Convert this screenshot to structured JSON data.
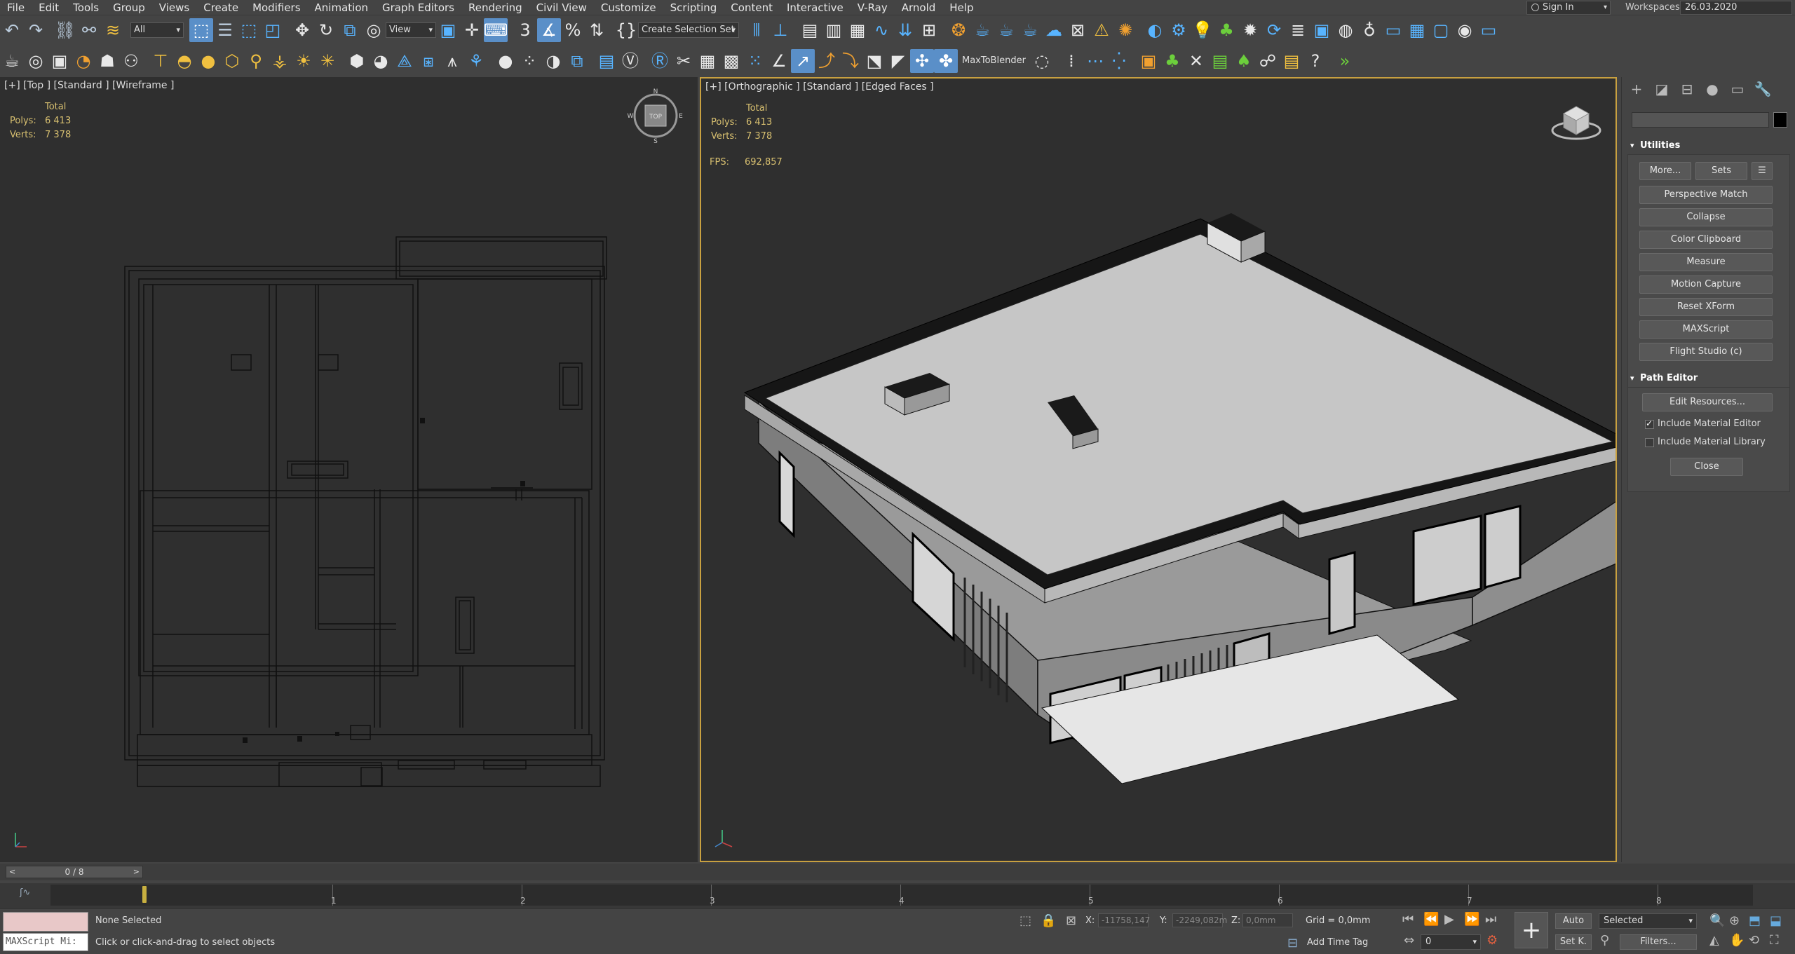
{
  "menubar": {
    "items": [
      "File",
      "Edit",
      "Tools",
      "Group",
      "Views",
      "Create",
      "Modifiers",
      "Animation",
      "Graph Editors",
      "Rendering",
      "Civil View",
      "Customize",
      "Scripting",
      "Content",
      "Interactive",
      "V-Ray",
      "Arnold",
      "Help"
    ],
    "sign_in": "Sign In",
    "workspaces_label": "Workspaces:",
    "workspace_value": "26.03.2020"
  },
  "toolbar": {
    "filter_value": "All",
    "ref_coord_value": "View",
    "selection_set_value": "Create Selection Set",
    "plugin_label": "MaxToBlender"
  },
  "viewport_top": {
    "label": "[+] [Top ] [Standard ] [Wireframe ]",
    "total_label": "Total",
    "polys_label": "Polys:",
    "polys_value": "6 413",
    "verts_label": "Verts:",
    "verts_value": "7 378",
    "cube_label": "TOP",
    "compass": {
      "n": "N",
      "s": "S",
      "e": "E",
      "w": "W"
    }
  },
  "viewport_ortho": {
    "label": "[+] [Orthographic ] [Standard ] [Edged Faces ]",
    "total_label": "Total",
    "polys_label": "Polys:",
    "polys_value": "6 413",
    "verts_label": "Verts:",
    "verts_value": "7 378",
    "fps_label": "FPS:",
    "fps_value": "692,857"
  },
  "command_panel": {
    "utilities_title": "Utilities",
    "more_button": "More...",
    "sets_button": "Sets",
    "utility_buttons": [
      "Perspective Match",
      "Collapse",
      "Color Clipboard",
      "Measure",
      "Motion Capture",
      "Reset XForm",
      "MAXScript",
      "Flight Studio (c)"
    ],
    "path_editor_title": "Path Editor",
    "edit_resources_button": "Edit Resources...",
    "include_material_editor": "Include Material Editor",
    "include_material_editor_checked": true,
    "include_material_library": "Include Material Library",
    "include_material_library_checked": false,
    "close_button": "Close"
  },
  "timeline": {
    "frame_display": "0 / 8",
    "prev": "<",
    "next": ">",
    "ticks": [
      "1",
      "2",
      "3",
      "4",
      "5",
      "6",
      "7",
      "8"
    ]
  },
  "status": {
    "maxscript_text": "MAXScript Mi:",
    "selection": "None Selected",
    "prompt": "Click or click-and-drag to select objects",
    "x_label": "X:",
    "x_value": "-11758,147",
    "y_label": "Y:",
    "y_value": "-2249,082m",
    "z_label": "Z:",
    "z_value": "0,0mm",
    "grid": "Grid = 0,0mm",
    "add_time_tag": "Add Time Tag",
    "auto_button": "Auto",
    "selected_value": "Selected",
    "setk_button": "Set K.",
    "filters_button": "Filters...",
    "frame_value": "0"
  }
}
